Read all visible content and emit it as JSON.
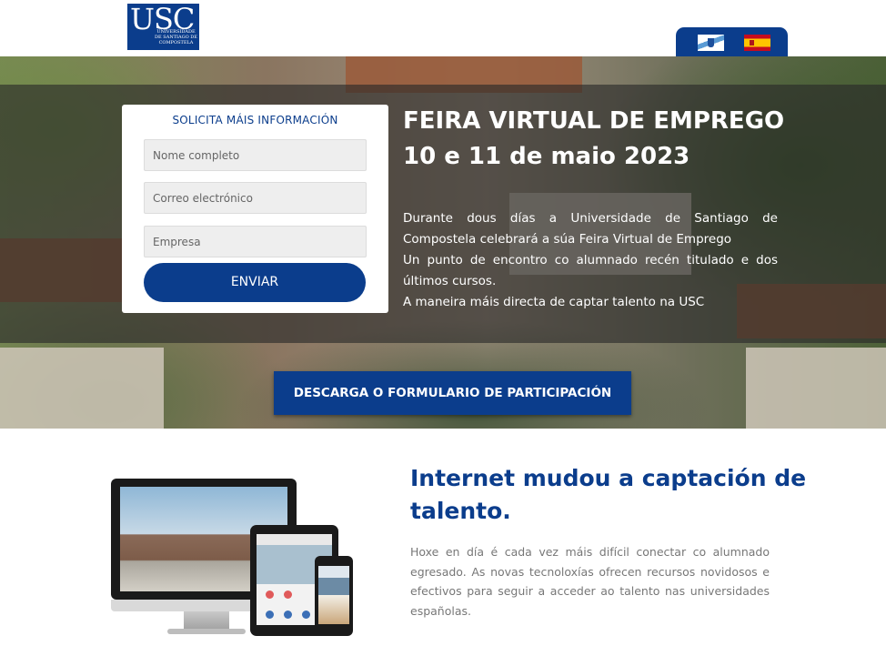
{
  "header": {
    "logo_text": "USC",
    "logo_subtext": "UNIVERSIDADE DE SANTIAGO DE COMPOSTELA",
    "languages": [
      {
        "name": "galician-flag-icon"
      },
      {
        "name": "spanish-flag-icon"
      }
    ]
  },
  "form": {
    "title": "SOLICITA MÁIS INFORMACIÓN",
    "name_placeholder": "Nome completo",
    "email_placeholder": "Correo electrónico",
    "company_placeholder": "Empresa",
    "submit_label": "ENVIAR"
  },
  "hero": {
    "title_line1": "FEIRA VIRTUAL DE EMPREGO",
    "title_line2": "10 e 11 de maio 2023",
    "paragraph1": "Durante dous días a Universidade de Santiago de Compostela celebrará a súa Feira Virtual de Emprego",
    "paragraph2": "Un punto de encontro co alumnado recén titulado e dos últimos cursos.",
    "paragraph3": "A maneira máis directa de captar talento na USC",
    "download_label": "DESCARGA O FORMULARIO DE PARTICIPACIÓN"
  },
  "section": {
    "title": "Internet mudou a captación de talento.",
    "text": "Hoxe en día é cada vez máis difícil conectar co alumnado egresado. As novas tecnoloxías ofrecen recursos novidosos e efectivos para seguir a acceder ao talento nas universidades españolas."
  },
  "colors": {
    "brand_blue": "#0b3d8c",
    "text_grey": "#777777"
  }
}
